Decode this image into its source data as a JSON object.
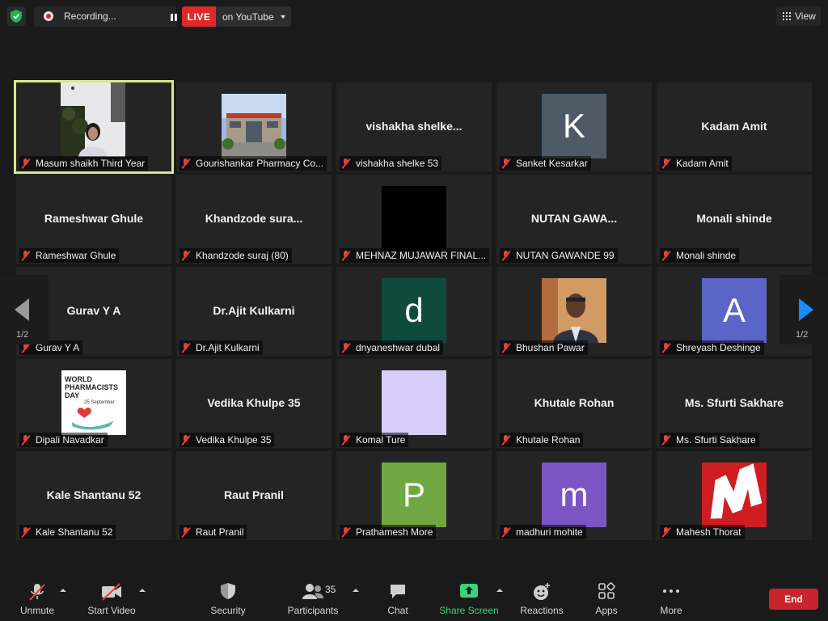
{
  "top_bar": {
    "recording_text": "Recording...",
    "live_tag": "LIVE",
    "live_dest": "on YouTube",
    "view_label": "View"
  },
  "gallery": {
    "page_left": "1/2",
    "page_right": "1/2",
    "tiles": [
      {
        "name": "Masum shaikh Third Year",
        "display": "video"
      },
      {
        "name": "Gourishankar Pharmacy Co...",
        "display": "image-building"
      },
      {
        "name": "vishakha shelke 53",
        "big": "vishakha  shelke..."
      },
      {
        "name": "Sanket Kesarkar",
        "letter": "K"
      },
      {
        "name": "Kadam Amit",
        "big": "Kadam Amit"
      },
      {
        "name": "Rameshwar Ghule",
        "big": "Rameshwar Ghule"
      },
      {
        "name": "Khandzode suraj (80)",
        "big": "Khandzode  sura..."
      },
      {
        "name": "MEHNAZ MUJAWAR FINAL...",
        "display": "black"
      },
      {
        "name": "NUTAN GAWANDE 99",
        "big": "NUTAN  GAWA..."
      },
      {
        "name": "Monali shinde",
        "big": "Monali shinde"
      },
      {
        "name": "Gurav Y A",
        "big": "Gurav Y A"
      },
      {
        "name": "Dr.Ajit Kulkarni",
        "big": "Dr.Ajit Kulkarni"
      },
      {
        "name": "dnyaneshwar dubal",
        "letter": "d"
      },
      {
        "name": "Bhushan Pawar",
        "display": "photo-man"
      },
      {
        "name": "Shreyash Deshinge",
        "letter": "A"
      },
      {
        "name": "Dipali Navadkar",
        "display": "pharmacists-day"
      },
      {
        "name": "Vedika Khulpe 35",
        "big": "Vedika Khulpe 35"
      },
      {
        "name": "Komal Ture",
        "display": "lavender"
      },
      {
        "name": "Khutale Rohan",
        "big": "Khutale Rohan"
      },
      {
        "name": "Ms. Sfurti Sakhare",
        "big": "Ms. Sfurti Sakhare"
      },
      {
        "name": "Kale Shantanu 52",
        "big": "Kale Shantanu 52"
      },
      {
        "name": "Raut Pranil",
        "big": "Raut Pranil"
      },
      {
        "name": "Prathamesh More",
        "letter": "P"
      },
      {
        "name": "madhuri mohite",
        "letter": "m"
      },
      {
        "name": "Mahesh Thorat",
        "display": "m-logo"
      }
    ],
    "pharma_poster": {
      "line1": "WORLD",
      "line2": "PHARMACISTS",
      "line3": "DAY",
      "date": "25 September"
    }
  },
  "colors": {
    "K": "#4e5b67",
    "d": "#0f4b3c",
    "A": "#5966c7",
    "P": "#6fa843",
    "m": "#7b55c4",
    "lavender": "#d6cdfb",
    "active_border": "#d8e88a",
    "live": "#e02828",
    "share": "#3ad37b",
    "end": "#c9242b"
  },
  "toolbar": {
    "unmute": "Unmute",
    "start_video": "Start Video",
    "security": "Security",
    "participants": "Participants",
    "participants_count": "35",
    "chat": "Chat",
    "share_screen": "Share Screen",
    "reactions": "Reactions",
    "apps": "Apps",
    "more": "More",
    "end": "End"
  }
}
